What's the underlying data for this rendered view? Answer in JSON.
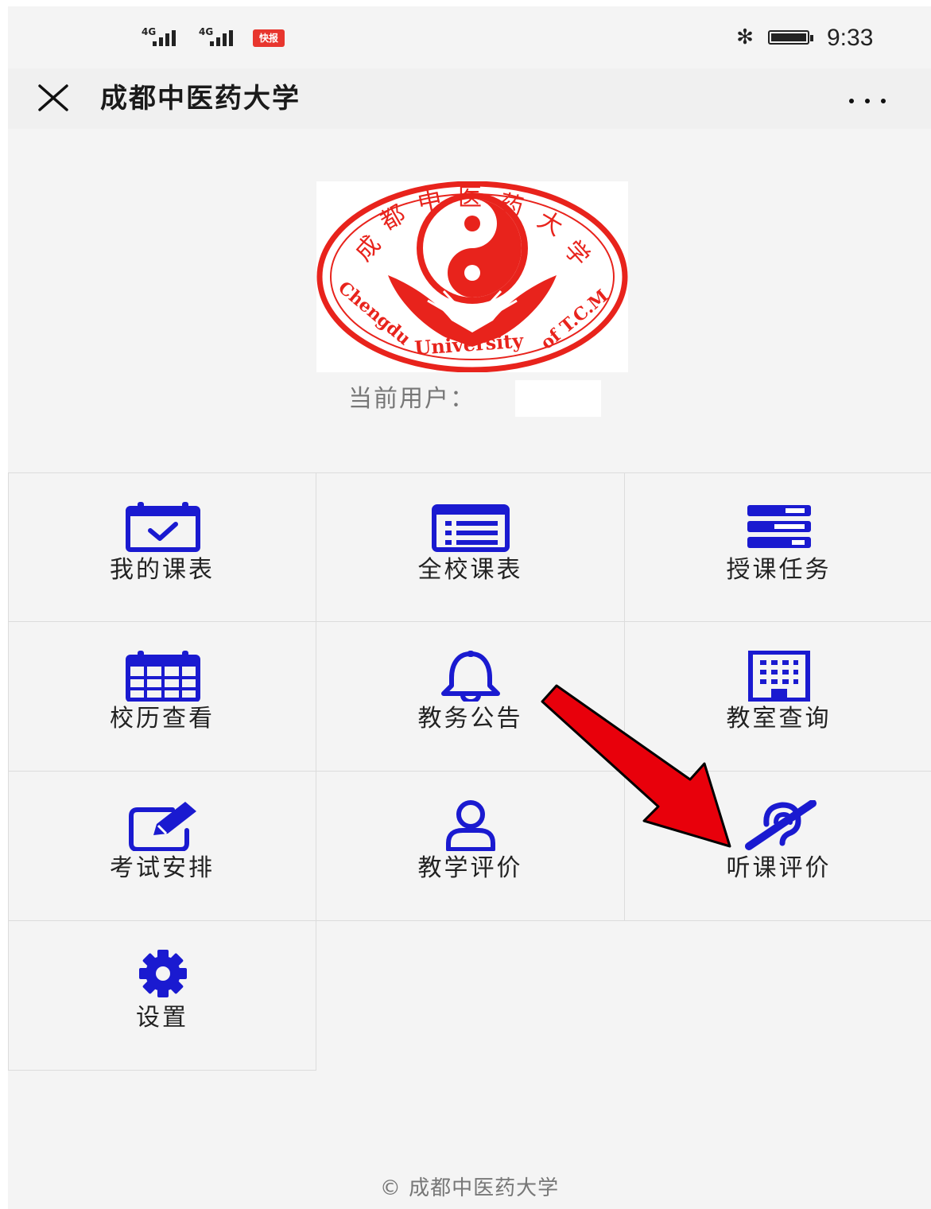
{
  "status_bar": {
    "signal_1": "4G",
    "signal_2": "4G",
    "news_badge": "快报",
    "bluetooth_icon": "bluetooth-icon",
    "battery_icon": "battery-icon",
    "time": "9:33"
  },
  "header": {
    "close_icon": "close-icon",
    "title": "成都中医药大学",
    "more_icon": "more-icon"
  },
  "logo": {
    "name": "Chengdu University of T.C.M",
    "text_cn": "成都中医药大学",
    "text_en": "Chengdu University of T.C.M",
    "color": "#e8231c"
  },
  "user": {
    "label": "当前用户：",
    "value": ""
  },
  "menu": {
    "icon_color": "#1a1ad0",
    "items": [
      {
        "label": "我的课表",
        "icon": "calendar-check-icon"
      },
      {
        "label": "全校课表",
        "icon": "list-alt-icon"
      },
      {
        "label": "授课任务",
        "icon": "tasks-icon"
      },
      {
        "label": "校历查看",
        "icon": "calendar-icon"
      },
      {
        "label": "教务公告",
        "icon": "bell-icon"
      },
      {
        "label": "教室查询",
        "icon": "building-icon"
      },
      {
        "label": "考试安排",
        "icon": "edit-icon"
      },
      {
        "label": "教学评价",
        "icon": "user-icon"
      },
      {
        "label": "听课评价",
        "icon": "hearing-icon"
      },
      {
        "label": "设置",
        "icon": "gear-icon"
      }
    ]
  },
  "annotation": {
    "arrow_color": "#e8000b"
  },
  "footer": {
    "copyright": "© 成都中医药大学"
  }
}
